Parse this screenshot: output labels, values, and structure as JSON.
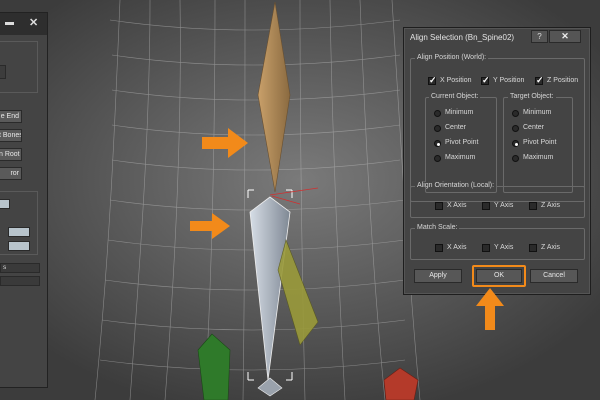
{
  "dialog": {
    "title": "Align Selection (Bn_Spine02)",
    "help_label": "?",
    "close_label": "✕",
    "align_position": {
      "label": "Align Position (World):",
      "checkboxes": [
        {
          "label": "X Position",
          "checked": true
        },
        {
          "label": "Y Position",
          "checked": true
        },
        {
          "label": "Z Position",
          "checked": true
        }
      ],
      "current_object": {
        "label": "Current Object:",
        "options": [
          "Minimum",
          "Center",
          "Pivot Point",
          "Maximum"
        ],
        "selected": "Pivot Point"
      },
      "target_object": {
        "label": "Target Object:",
        "options": [
          "Minimum",
          "Center",
          "Pivot Point",
          "Maximum"
        ],
        "selected": "Pivot Point"
      }
    },
    "align_orientation": {
      "label": "Align Orientation (Local):",
      "checkboxes": [
        {
          "label": "X Axis",
          "checked": false
        },
        {
          "label": "Y Axis",
          "checked": false
        },
        {
          "label": "Z Axis",
          "checked": false
        }
      ]
    },
    "match_scale": {
      "label": "Match Scale:",
      "checkboxes": [
        {
          "label": "X Axis",
          "checked": false
        },
        {
          "label": "Y Axis",
          "checked": false
        },
        {
          "label": "Z Axis",
          "checked": false
        }
      ]
    },
    "buttons": {
      "apply": "Apply",
      "ok": "OK",
      "cancel": "Cancel"
    }
  },
  "left_panel": {
    "buttons": [
      "e End",
      "t Bones",
      "n Root",
      "ror"
    ],
    "bar_label": "s"
  },
  "colors": {
    "highlight": "#f28a1a",
    "bone_tan": "#b08a55",
    "bone_gray": "#aab4c0",
    "bone_yellow": "#9a9a3a",
    "bone_green": "#2f7a2a",
    "bone_red": "#b43a2a"
  }
}
